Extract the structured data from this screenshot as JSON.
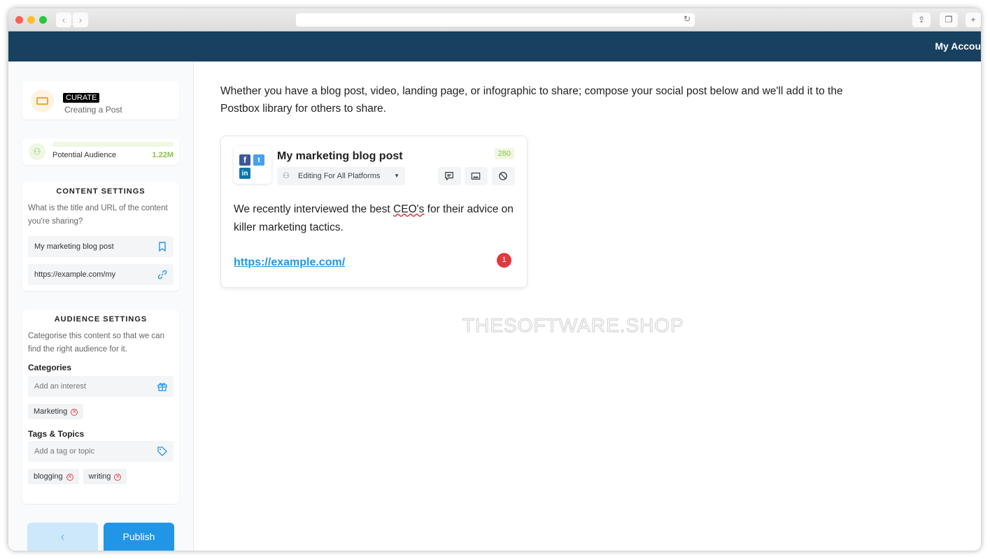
{
  "browser": {
    "back": "‹",
    "forward": "›"
  },
  "header": {
    "account": "My Accou"
  },
  "sidebar": {
    "mode_badge": "CURATE",
    "mode_title": "Creating a Post",
    "audience": {
      "label": "Potential Audience",
      "value": "1.22M"
    },
    "content_settings": {
      "title": "CONTENT SETTINGS",
      "description": "What is the title and URL of the content you're sharing?",
      "title_value": "My marketing blog post",
      "url_value": "https://example.com/my"
    },
    "audience_settings": {
      "title": "AUDIENCE SETTINGS",
      "description": "Categorise this content so that we can find the right audience for it.",
      "categories_label": "Categories",
      "categories_placeholder": "Add an interest",
      "categories": [
        "Marketing"
      ],
      "tags_label": "Tags & Topics",
      "tags_placeholder": "Add a tag or topic",
      "tags": [
        "blogging",
        "writing"
      ]
    },
    "back_label": "‹",
    "publish_label": "Publish"
  },
  "main": {
    "intro": "Whether you have a blog post, video, landing page, or infographic to share; compose your social post below and we'll add it to the Postbox library for others to share.",
    "post": {
      "title": "My marketing blog post",
      "char_count": "280",
      "platform_select": "Editing For All Platforms",
      "body_pre": "We recently interviewed the best ",
      "body_misspelled": "CEO's",
      "body_post": " for their advice on killer marketing tactics.",
      "link": "https://example.com/",
      "notification_count": "1"
    }
  },
  "watermark": "THESOFTWARE.SHOP",
  "colors": {
    "header": "#17415f",
    "accent": "#2196e6",
    "green": "#8bc34a",
    "error": "#e0393e"
  }
}
